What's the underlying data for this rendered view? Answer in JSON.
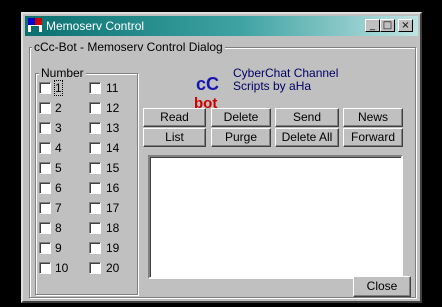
{
  "window": {
    "title": "Memoserv Control"
  },
  "titlebar_buttons": {
    "minimize": "_",
    "maximize": "□",
    "close": "×"
  },
  "dialog_group": "cCc-Bot - Memoserv Control Dialog",
  "number_group": "Number",
  "numbers_left": [
    "1",
    "2",
    "3",
    "4",
    "5",
    "6",
    "7",
    "8",
    "9",
    "10"
  ],
  "numbers_right": [
    "11",
    "12",
    "13",
    "14",
    "15",
    "16",
    "17",
    "18",
    "19",
    "20"
  ],
  "logo": {
    "top": "cC",
    "bottom": "bot",
    "line1": "CyberChat Channel",
    "line2": "Scripts by aHa"
  },
  "buttons": {
    "read": "Read",
    "delete": "Delete",
    "send": "Send",
    "news": "News",
    "list": "List",
    "purge": "Purge",
    "delete_all": "Delete All",
    "forward": "Forward",
    "close": "Close"
  },
  "message_text": ""
}
